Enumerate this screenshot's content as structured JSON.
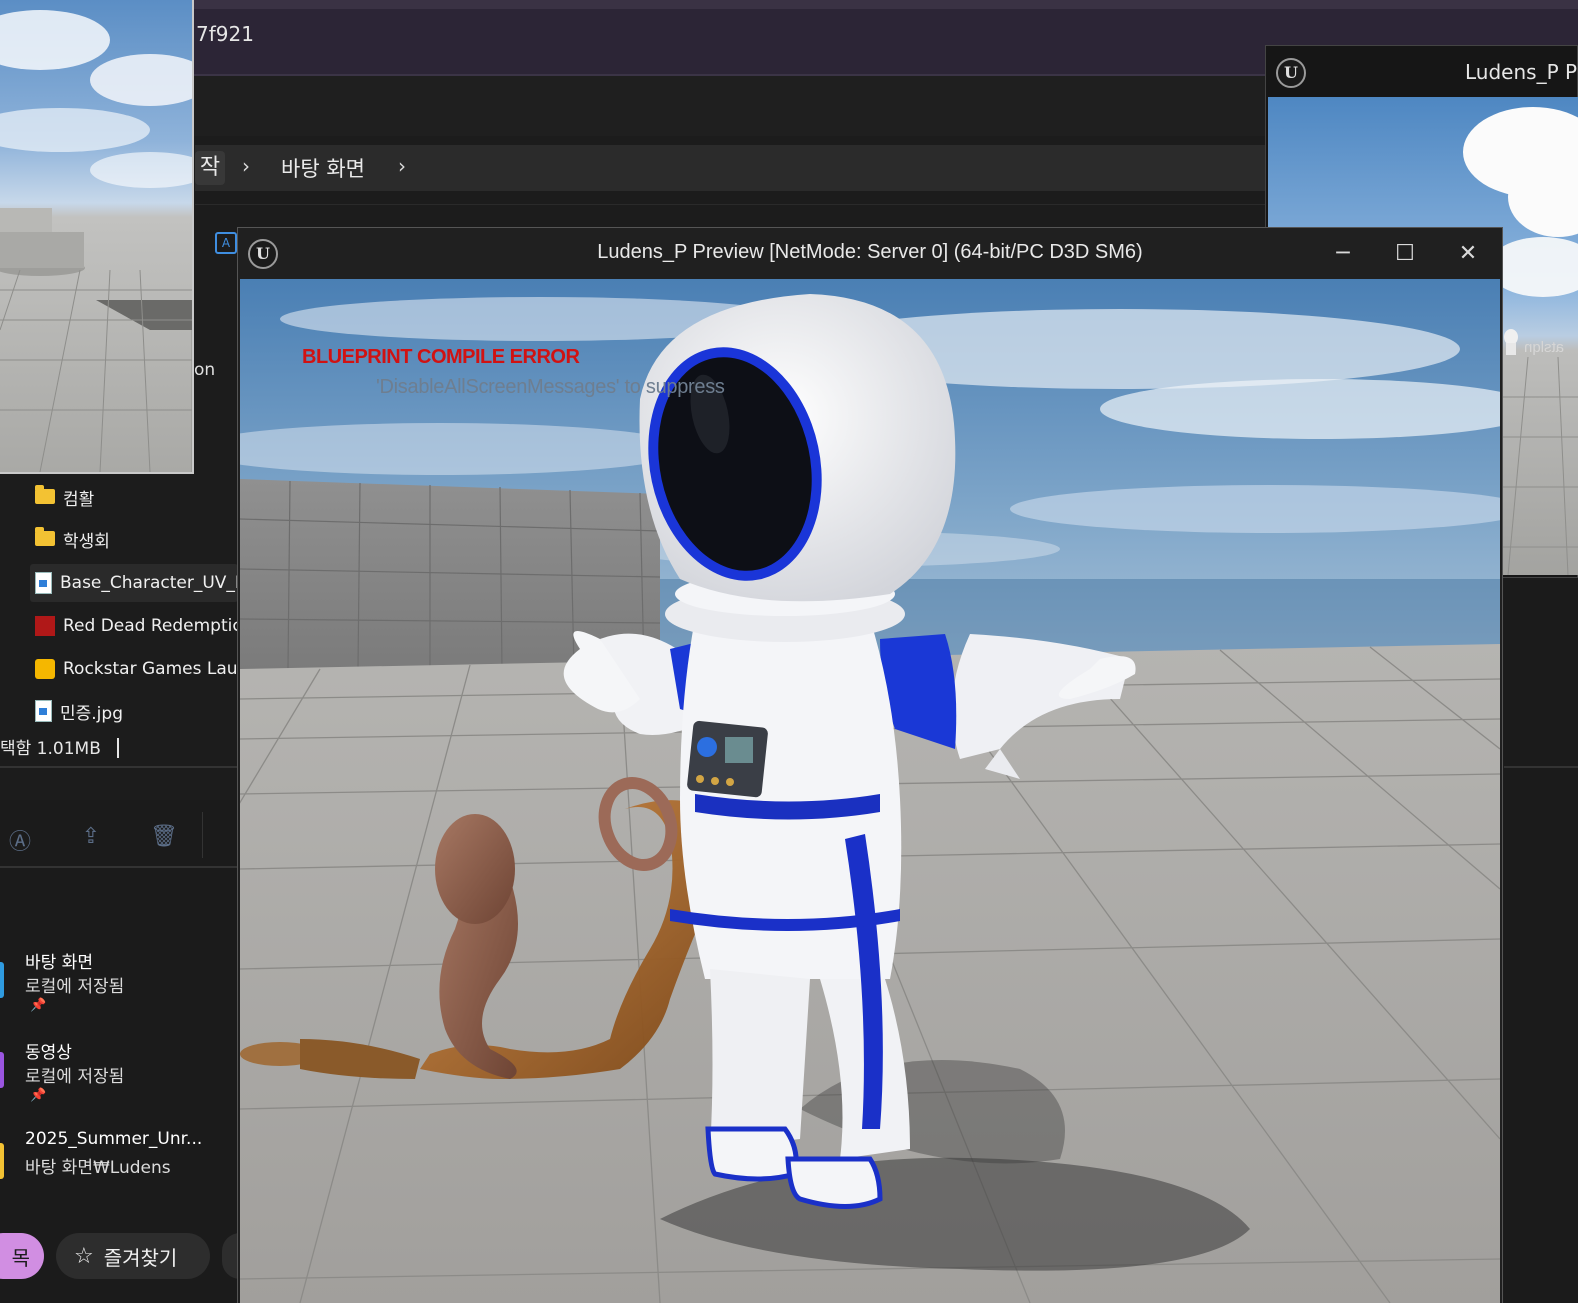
{
  "explorer": {
    "title_fragment": "7f921",
    "breadcrumb_current_fragment": "작",
    "breadcrumb_desktop": "바탕 화면",
    "cut_text": "on",
    "files": [
      {
        "name": "컴활",
        "icon": "folder-icon"
      },
      {
        "name": "학생회",
        "icon": "folder-icon"
      },
      {
        "name": "Base_Character_UV_B",
        "icon": "image-file-icon"
      },
      {
        "name": "Red Dead Redemptic",
        "icon": "rdr-app-icon"
      },
      {
        "name": "Rockstar Games Laur",
        "icon": "rockstar-launcher-icon"
      },
      {
        "name": "민증.jpg",
        "icon": "image-file-icon"
      }
    ],
    "status": "택함  1.01MB",
    "quick_access": [
      {
        "title": "바탕 화면",
        "subtitle": "로컬에 저장됨",
        "pinned": true,
        "color": "#2f9be0"
      },
      {
        "title": "동영상",
        "subtitle": "로컬에 저장됨",
        "pinned": true,
        "color": "#9a55e0"
      },
      {
        "title": "2025_Summer_Unr...",
        "subtitle": "바탕 화면₩Ludens",
        "pinned": false,
        "color": "#f3c233"
      }
    ],
    "chip_pink_fragment": "목",
    "chip_favorites": "즐겨찾기"
  },
  "secondary_window": {
    "title": "Ludens_P P",
    "mirrored_text": "atslqn"
  },
  "game_window": {
    "title": "Ludens_P Preview [NetMode: Server 0]  (64-bit/PC D3D SM6)",
    "minimize_label": "─",
    "maximize_label": "☐",
    "close_label": "✕",
    "error_title": "BLUEPRINT COMPILE ERROR",
    "error_sub": "'DisableAllScreenMessages' to suppress"
  },
  "colors": {
    "error": "#d11212",
    "suit_blue": "#1430c8",
    "accent_blue": "#3f8ee0"
  }
}
